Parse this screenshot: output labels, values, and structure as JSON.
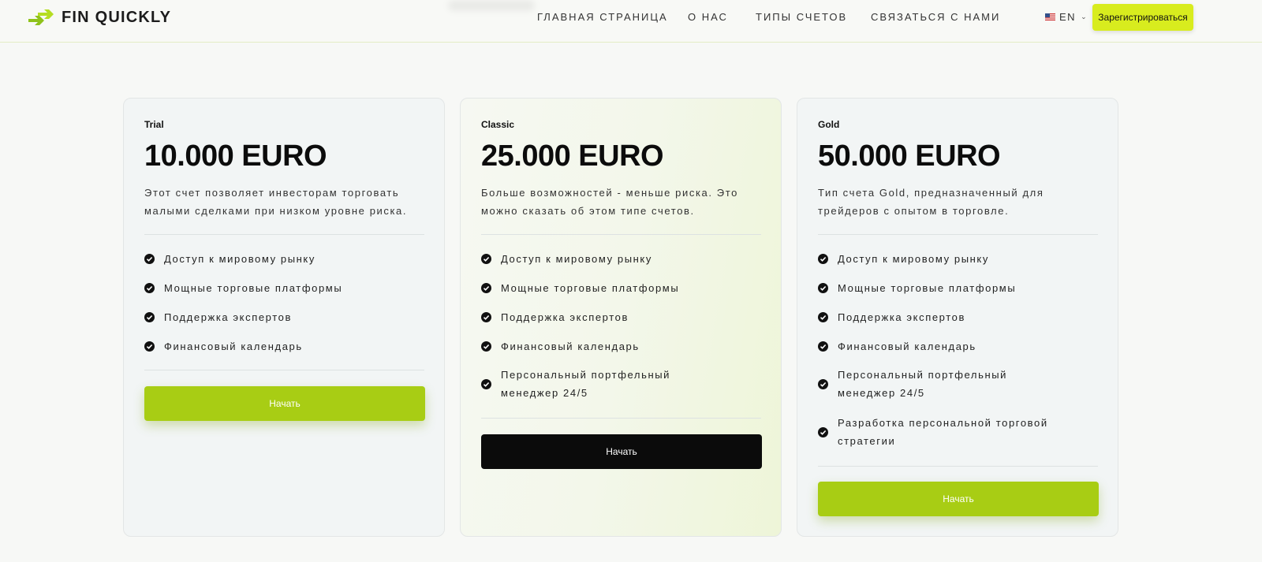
{
  "header": {
    "logo_text": "FIN QUICKLY",
    "nav": [
      "ГЛАВНАЯ СТРАНИЦА",
      "О НАС",
      "ТИПЫ СЧЕТОВ",
      "СВЯЗАТЬСЯ С НАМИ"
    ],
    "lang": "EN",
    "register_label": "Зарегистрироваться"
  },
  "colors": {
    "accent": "#a8cd14",
    "register": "#d8ec1e",
    "dark_button": "#0b0b0b"
  },
  "cards": [
    {
      "plan": "Trial",
      "price": "10.000 EURO",
      "desc": "Этот счет позволяет инвесторам торговать малыми сделками при низком уровне риска.",
      "features": [
        "Доступ к мировому рынку",
        "Мощные торговые платформы",
        "Поддержка экспертов",
        "Финансовый календарь"
      ],
      "button": "Начать"
    },
    {
      "plan": "Classic",
      "price": "25.000 EURO",
      "desc": "Больше возможностей - меньше риска. Это можно сказать об этом типе счетов.",
      "features": [
        "Доступ к мировому рынку",
        "Мощные торговые платформы",
        "Поддержка экспертов",
        "Финансовый календарь",
        "Персональный портфельный менеджер 24/5"
      ],
      "button": "Начать"
    },
    {
      "plan": "Gold",
      "price": "50.000 EURO",
      "desc": "Тип счета Gold, предназначенный для трейдеров с опытом в торговле.",
      "features": [
        "Доступ к мировому рынку",
        "Мощные торговые платформы",
        "Поддержка экспертов",
        "Финансовый календарь",
        "Персональный портфельный менеджер 24/5",
        "Разработка персональной торговой стратегии"
      ],
      "button": "Начать"
    }
  ]
}
